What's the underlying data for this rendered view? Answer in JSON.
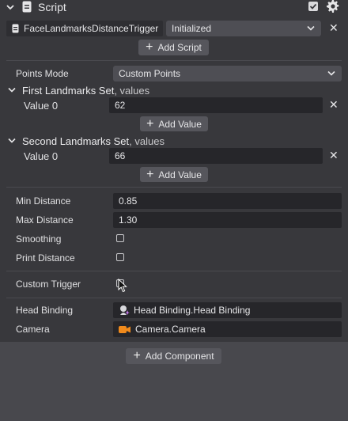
{
  "script_header": {
    "title": "Script",
    "enabled_checked": true
  },
  "script_row": {
    "script_name": "FaceLandmarksDistanceTrigger",
    "status_value": "Initialized"
  },
  "buttons": {
    "add_script": "Add Script",
    "add_value": "Add Value",
    "add_component": "Add Component"
  },
  "points_mode": {
    "label": "Points Mode",
    "value": "Custom Points"
  },
  "first_set": {
    "title": "First Landmarks Set",
    "suffix": ", values",
    "value_label": "Value 0",
    "value": "62"
  },
  "second_set": {
    "title": "Second Landmarks Set",
    "suffix": ", values",
    "value_label": "Value 0",
    "value": "66"
  },
  "min_distance": {
    "label": "Min Distance",
    "value": "0.85"
  },
  "max_distance": {
    "label": "Max Distance",
    "value": "1.30"
  },
  "smoothing": {
    "label": "Smoothing",
    "checked": false
  },
  "print_distance": {
    "label": "Print Distance",
    "checked": false
  },
  "custom_trigger": {
    "label": "Custom Trigger",
    "checked": false
  },
  "head_binding": {
    "label": "Head Binding",
    "value": "Head Binding.Head Binding"
  },
  "camera": {
    "label": "Camera",
    "value": "Camera.Camera"
  }
}
